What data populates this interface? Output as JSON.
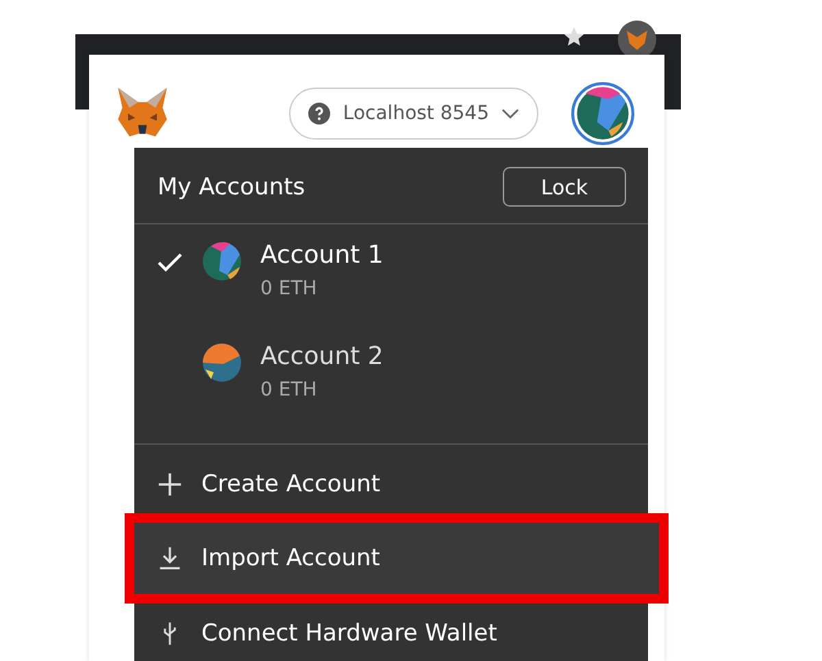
{
  "network": {
    "label": "Localhost 8545"
  },
  "menu": {
    "title": "My Accounts",
    "lock_button": "Lock",
    "accounts": [
      {
        "name": "Account 1",
        "balance": "0 ETH",
        "selected": true,
        "kind": "blue"
      },
      {
        "name": "Account 2",
        "balance": "0 ETH",
        "selected": false,
        "kind": "orange"
      }
    ],
    "actions": [
      {
        "kind": "create",
        "label": "Create Account"
      },
      {
        "kind": "import",
        "label": "Import Account",
        "highlighted": true
      },
      {
        "kind": "hardware",
        "label": "Connect Hardware Wallet"
      }
    ]
  }
}
